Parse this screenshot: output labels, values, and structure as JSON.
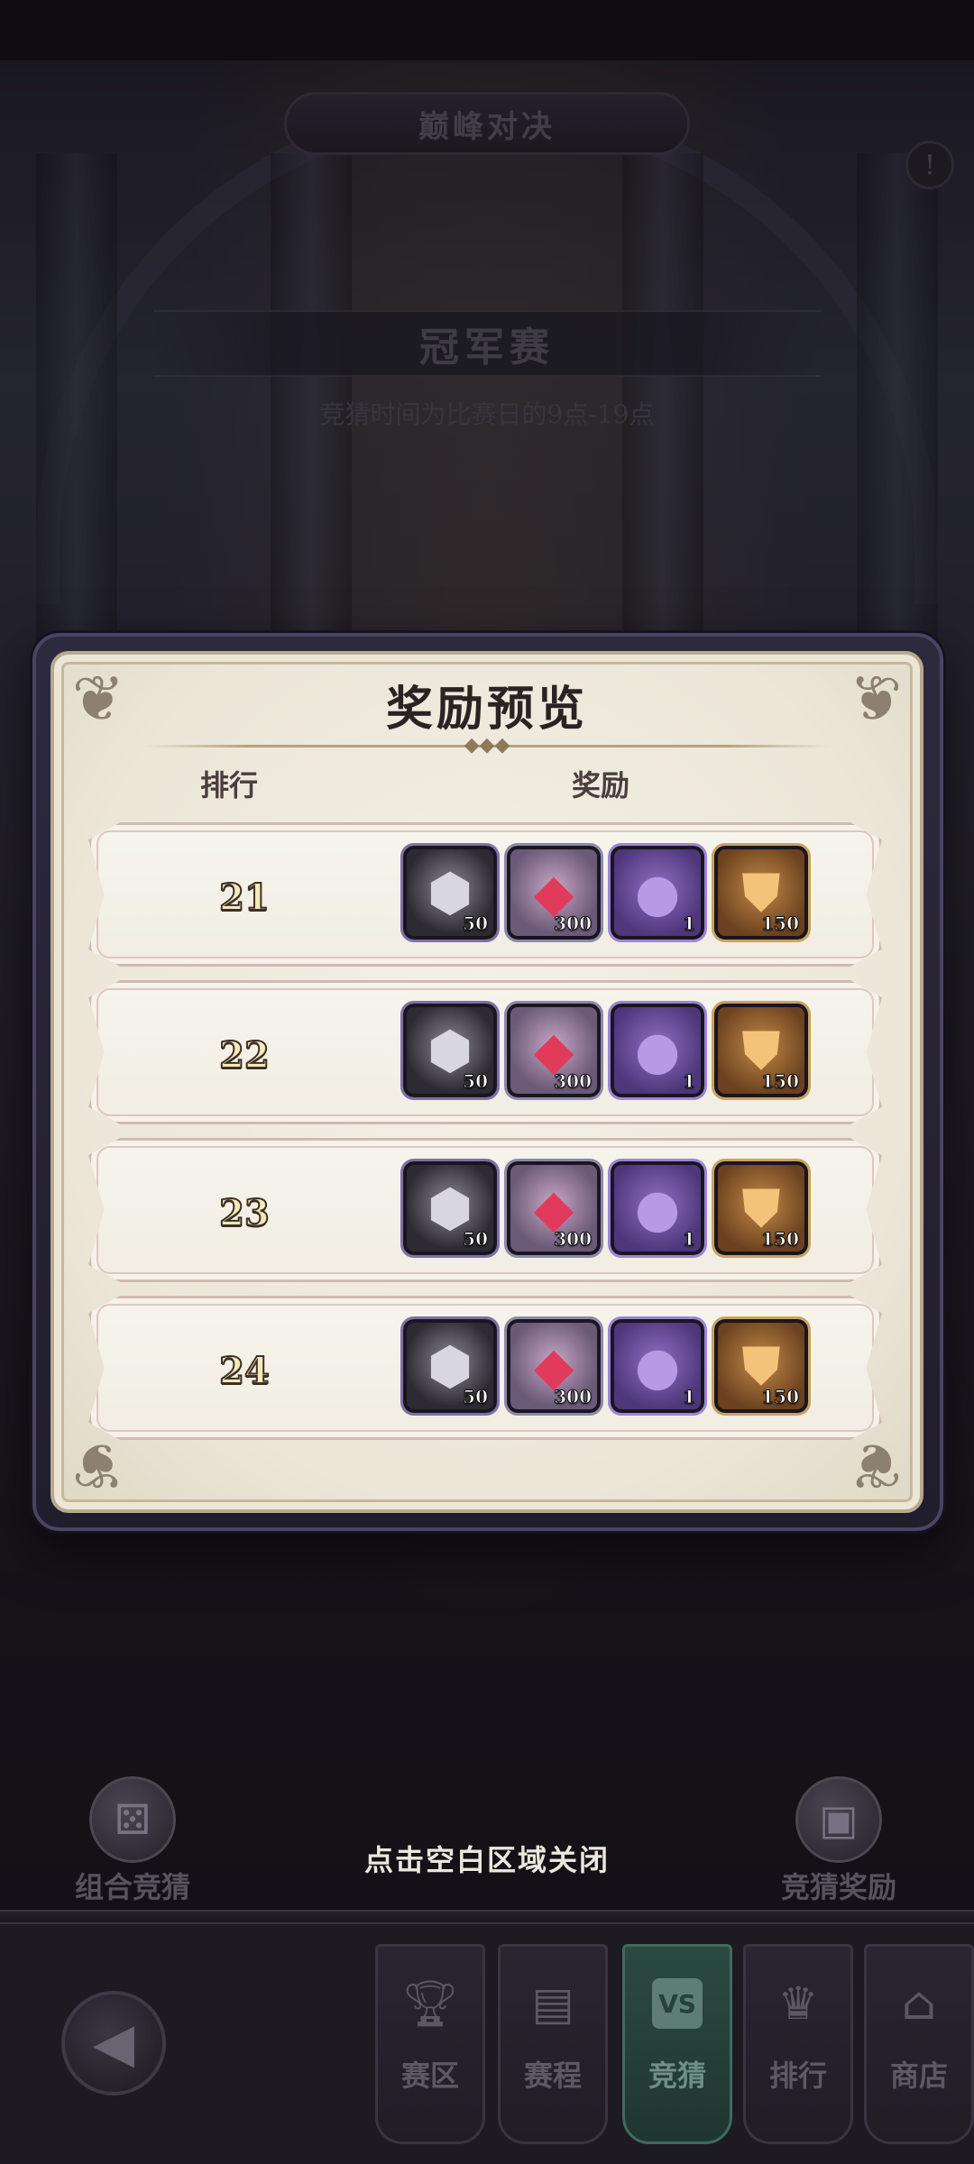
{
  "background": {
    "header_title": "巅峰对决",
    "stage_title": "冠军赛",
    "bet_time_text": "竞猜时间为比赛日的9点-19点",
    "info_icon": "exclamation-icon"
  },
  "popup": {
    "title": "奖励预览",
    "columns": {
      "rank": "排行",
      "reward": "奖励"
    },
    "rows": [
      {
        "rank": "21",
        "rewards": [
          {
            "icon": "crystal-icon",
            "qty": "50"
          },
          {
            "icon": "red-gem-icon",
            "qty": "300"
          },
          {
            "icon": "bag-icon",
            "qty": "1"
          },
          {
            "icon": "badge-icon",
            "qty": "150"
          }
        ]
      },
      {
        "rank": "22",
        "rewards": [
          {
            "icon": "crystal-icon",
            "qty": "50"
          },
          {
            "icon": "red-gem-icon",
            "qty": "300"
          },
          {
            "icon": "bag-icon",
            "qty": "1"
          },
          {
            "icon": "badge-icon",
            "qty": "150"
          }
        ]
      },
      {
        "rank": "23",
        "rewards": [
          {
            "icon": "crystal-icon",
            "qty": "50"
          },
          {
            "icon": "red-gem-icon",
            "qty": "300"
          },
          {
            "icon": "bag-icon",
            "qty": "1"
          },
          {
            "icon": "badge-icon",
            "qty": "150"
          }
        ]
      },
      {
        "rank": "24",
        "rewards": [
          {
            "icon": "crystal-icon",
            "qty": "50"
          },
          {
            "icon": "red-gem-icon",
            "qty": "300"
          },
          {
            "icon": "bag-icon",
            "qty": "1"
          },
          {
            "icon": "badge-icon",
            "qty": "150"
          }
        ]
      }
    ]
  },
  "bottom": {
    "close_hint": "点击空白区域关闭",
    "left_button": "组合竞猜",
    "right_button": "竞猜奖励"
  },
  "nav": {
    "tabs": [
      {
        "label": "赛区",
        "icon": "trophy-icon",
        "active": false
      },
      {
        "label": "赛程",
        "icon": "schedule-icon",
        "active": false
      },
      {
        "label": "竞猜",
        "icon": "vs-icon",
        "badge": "VS",
        "active": true
      },
      {
        "label": "排行",
        "icon": "crown-icon",
        "active": false
      },
      {
        "label": "商店",
        "icon": "shop-icon",
        "active": false
      }
    ]
  },
  "colors": {
    "popup_paper": "#ebe6d8",
    "active_tab": "#2b4a42",
    "rank_text": "#f6e9b8"
  }
}
